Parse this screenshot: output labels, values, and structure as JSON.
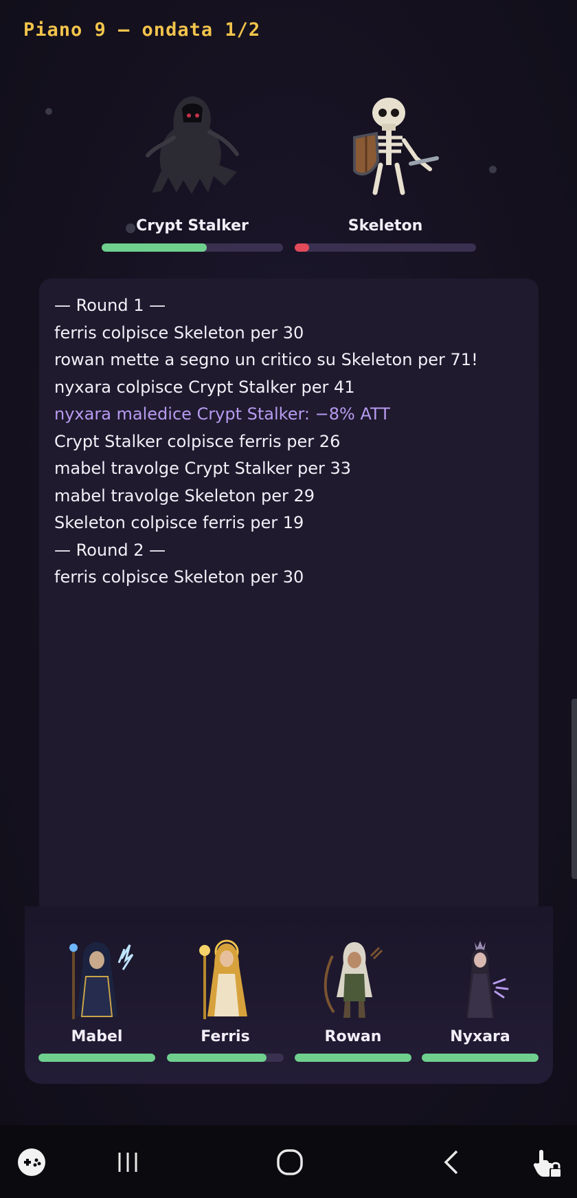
{
  "header": {
    "floor_title": "Piano 9 — ondata 1/2"
  },
  "enemies": [
    {
      "name": "Crypt Stalker",
      "hp_fraction": 0.58,
      "hp_color": "#6fd08e",
      "icon": "crypt-stalker-sprite"
    },
    {
      "name": "Skeleton",
      "hp_fraction": 0.08,
      "hp_color": "#e24a5a",
      "icon": "skeleton-sprite"
    }
  ],
  "battle_log": [
    {
      "text": "— Round 1 —",
      "type": "round"
    },
    {
      "text": "ferris colpisce Skeleton per 30",
      "type": "normal"
    },
    {
      "text": "rowan mette a segno un critico su Skeleton per 71!",
      "type": "normal"
    },
    {
      "text": "nyxara colpisce Crypt Stalker per 41",
      "type": "normal"
    },
    {
      "text": "nyxara maledice Crypt Stalker: −8% ATT",
      "type": "curse"
    },
    {
      "text": "Crypt Stalker colpisce ferris per 26",
      "type": "normal"
    },
    {
      "text": "mabel travolge Crypt Stalker per 33",
      "type": "normal"
    },
    {
      "text": "mabel travolge Skeleton per 29",
      "type": "normal"
    },
    {
      "text": "Skeleton colpisce ferris per 19",
      "type": "normal"
    },
    {
      "text": "— Round 2 —",
      "type": "round"
    },
    {
      "text": "ferris colpisce Skeleton per 30",
      "type": "normal"
    }
  ],
  "party": [
    {
      "name": "Mabel",
      "hp_fraction": 1.0,
      "icon": "mage-sprite"
    },
    {
      "name": "Ferris",
      "hp_fraction": 0.85,
      "icon": "priestess-sprite"
    },
    {
      "name": "Rowan",
      "hp_fraction": 1.0,
      "icon": "ranger-sprite"
    },
    {
      "name": "Nyxara",
      "hp_fraction": 1.0,
      "icon": "witch-sprite"
    }
  ],
  "colors": {
    "hp_green": "#6fd08e",
    "hp_red": "#e24a5a",
    "title_gold": "#f2c44c",
    "curse_purple": "#b79bf0"
  },
  "navbar": {
    "icons": [
      "game-launcher-icon",
      "recent-apps-icon",
      "home-icon",
      "back-icon",
      "touch-lock-icon"
    ]
  }
}
